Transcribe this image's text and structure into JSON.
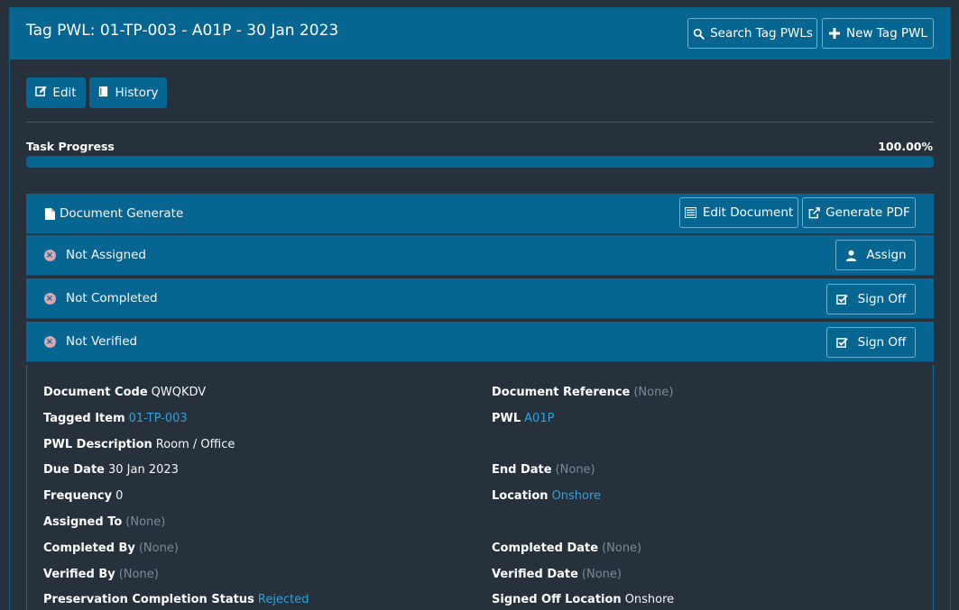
{
  "header": {
    "title": "Tag PWL: 01-TP-003 - A01P - 30 Jan 2023",
    "search_button": "Search Tag PWLs",
    "new_button": "New Tag PWL"
  },
  "toolbar": {
    "edit_label": "Edit",
    "history_label": "History"
  },
  "progress": {
    "label": "Task Progress",
    "value_text": "100.00%",
    "fraction": 1.0
  },
  "rows": {
    "document": {
      "label": "Document Generate",
      "edit_button": "Edit Document",
      "pdf_button": "Generate PDF"
    },
    "assigned": {
      "label": "Not Assigned",
      "button": "Assign"
    },
    "completed": {
      "label": "Not Completed",
      "button": "Sign Off"
    },
    "verified": {
      "label": "Not Verified",
      "button": "Sign Off"
    }
  },
  "details": {
    "document_code": {
      "label": "Document Code",
      "value": "QWQKDV"
    },
    "document_reference": {
      "label": "Document Reference",
      "value": "(None)"
    },
    "tagged_item": {
      "label": "Tagged Item",
      "value": "01-TP-003"
    },
    "pwl": {
      "label": "PWL",
      "value": "A01P"
    },
    "pwl_description": {
      "label": "PWL Description",
      "value": "Room / Office"
    },
    "due_date": {
      "label": "Due Date",
      "value": "30 Jan 2023"
    },
    "end_date": {
      "label": "End Date",
      "value": "(None)"
    },
    "frequency": {
      "label": "Frequency",
      "value": "0"
    },
    "location": {
      "label": "Location",
      "value": "Onshore"
    },
    "assigned_to": {
      "label": "Assigned To",
      "value": "(None)"
    },
    "completed_by": {
      "label": "Completed By",
      "value": "(None)"
    },
    "completed_date": {
      "label": "Completed Date",
      "value": "(None)"
    },
    "verified_by": {
      "label": "Verified By",
      "value": "(None)"
    },
    "verified_date": {
      "label": "Verified Date",
      "value": "(None)"
    },
    "preservation_status": {
      "label": "Preservation Completion Status",
      "value": "Rejected"
    },
    "signed_off_location": {
      "label": "Signed Off Location",
      "value": "Onshore"
    }
  },
  "colors": {
    "header_bg": "#076592",
    "page_bg": "#26313b",
    "link": "#2ea3dd",
    "muted": "#7c8a95",
    "status_icon": "#d9a7ad"
  }
}
